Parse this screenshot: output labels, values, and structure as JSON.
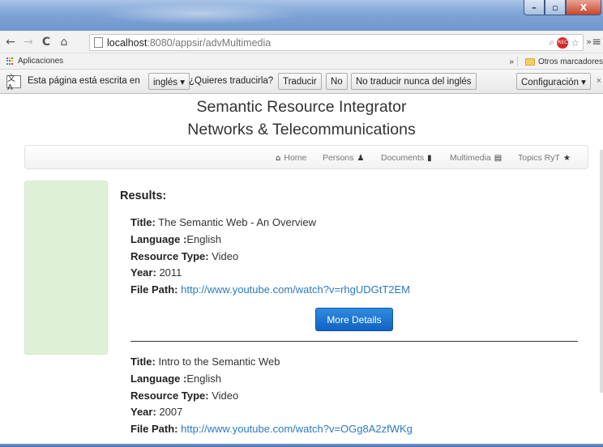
{
  "window": {
    "minimize": "–",
    "maximize": "▫",
    "close": "X"
  },
  "browser": {
    "address": {
      "host": "localhost",
      "path": ":8080/appsir/advMultimedia"
    },
    "omnibox_icons": [
      "search-icon",
      "record-icon",
      "star-icon"
    ],
    "record_label": "REC",
    "bookmarks": {
      "apps_label": "Aplicaciones",
      "other_label": "Otros marcadores",
      "chevron": "»"
    },
    "translate_bar": {
      "message": "Esta página está escrita en",
      "language": "inglés ▾",
      "question": "¿Quieres traducirla?",
      "translate_button": "Traducir",
      "no_button": "No",
      "never_button": "No traducir nunca del inglés",
      "settings_button": "Configuración ▾",
      "close": "×"
    }
  },
  "site": {
    "title_line1": "Semantic Resource Integrator",
    "title_line2": "Networks & Telecommunications",
    "nav": [
      {
        "label": "Home",
        "icon": "home-icon"
      },
      {
        "label": "Persons",
        "icon": "user-icon"
      },
      {
        "label": "Documents",
        "icon": "file-icon"
      },
      {
        "label": "Multimedia",
        "icon": "film-icon"
      },
      {
        "label": "Topics RyT",
        "icon": "star-icon"
      }
    ]
  },
  "results": {
    "heading": "Results:",
    "labels": {
      "title": "Title:",
      "language": "Language :",
      "resource_type": "Resource Type:",
      "year": "Year:",
      "file_path": "File Path:"
    },
    "items": [
      {
        "title": "The Semantic Web - An Overview",
        "language": "English",
        "resource_type": "Video",
        "year": "2011",
        "file_path": "http://www.youtube.com/watch?v=rhgUDGtT2EM"
      },
      {
        "title": "Intro to the Semantic Web",
        "language": "English",
        "resource_type": "Video",
        "year": "2007",
        "file_path": "http://www.youtube.com/watch?v=OGg8A2zfWKg"
      }
    ],
    "more_details_label": "More Details"
  },
  "colors": {
    "link": "#2a7ac0",
    "button_primary": "#1a73d6",
    "sidebar_bg": "#dff0d8"
  }
}
